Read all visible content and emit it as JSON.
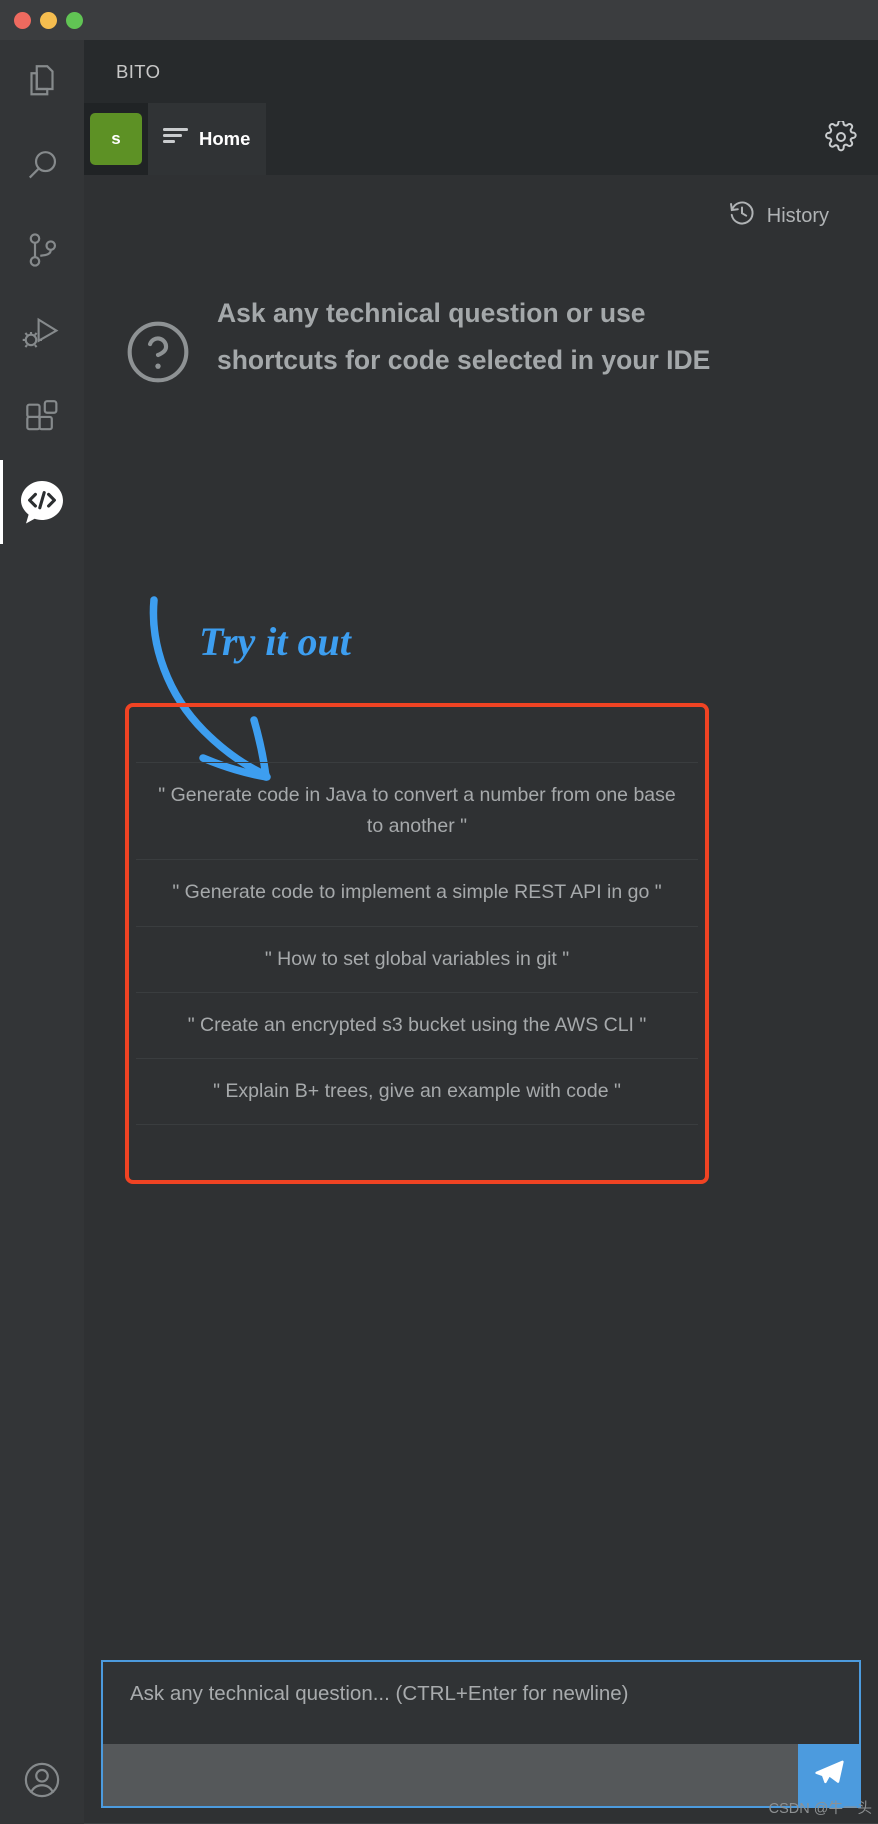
{
  "window": {
    "traffic_lights": [
      "close",
      "minimize",
      "zoom"
    ],
    "colors": {
      "close": "#ee6a5f",
      "minimize": "#f5bd4f",
      "zoom": "#61c454"
    }
  },
  "activity_bar": {
    "items": [
      {
        "name": "explorer",
        "icon": "files-icon",
        "active": false
      },
      {
        "name": "search",
        "icon": "search-icon",
        "active": false
      },
      {
        "name": "source-control",
        "icon": "source-control-icon",
        "active": false
      },
      {
        "name": "run-and-debug",
        "icon": "run-debug-icon",
        "active": false
      },
      {
        "name": "extensions",
        "icon": "extensions-icon",
        "active": false
      },
      {
        "name": "bito",
        "icon": "bito-code-chat-icon",
        "active": true
      }
    ],
    "bottom": [
      {
        "name": "accounts",
        "icon": "account-icon"
      }
    ]
  },
  "panel": {
    "title": "BITO",
    "avatar_initial": "s",
    "avatar_color": "#5d9125",
    "tab": {
      "label": "Home",
      "icon": "list-lines-icon"
    },
    "settings_icon": "gear-icon"
  },
  "content": {
    "history": {
      "label": "History",
      "icon": "history-clock-icon"
    },
    "hero": {
      "icon": "question-mark-circle-icon",
      "text": "Ask any technical question or use shortcuts for code selected in your IDE"
    },
    "annotation": {
      "text": "Try it out",
      "color": "#3d9ef0",
      "arrow": "curved-down-right-arrow"
    },
    "highlight_box_color": "#f04323",
    "suggestions": [
      "\" Generate code in Java to convert a number from one base to another \"",
      "\" Generate code to implement a simple REST API in go \"",
      "\" How to set global variables in git \"",
      "\" Create an encrypted s3 bucket using the AWS CLI \"",
      "\" Explain B+ trees, give an example with code \""
    ]
  },
  "composer": {
    "placeholder": "Ask any technical question... (CTRL+Enter for newline)",
    "value": "",
    "send_icon": "send-paper-plane-icon",
    "send_color": "#4c9bde",
    "border_color": "#4c9bde"
  },
  "watermark": "CSDN @牛一头"
}
